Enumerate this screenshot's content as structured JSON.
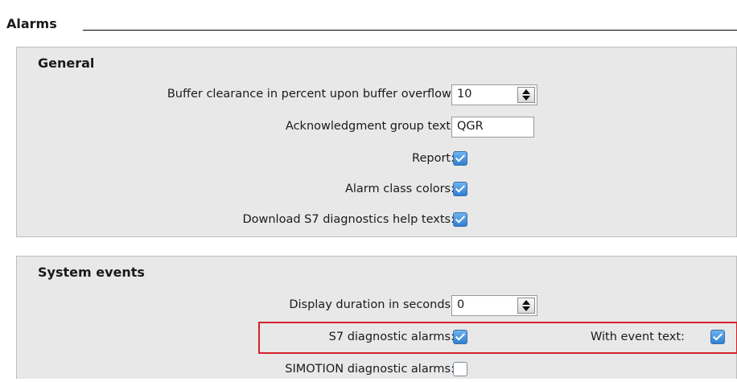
{
  "section": {
    "title": "Alarms"
  },
  "general": {
    "title": "General",
    "buffer_clearance": {
      "label": "Buffer clearance in percent upon buffer overflow:",
      "value": "10"
    },
    "ack_group_text": {
      "label": "Acknowledgment group text:",
      "value": "QGR"
    },
    "report": {
      "label": "Report:",
      "checked": true
    },
    "alarm_class_colors": {
      "label": "Alarm class colors:",
      "checked": true
    },
    "download_s7_help": {
      "label": "Download S7 diagnostics help texts:",
      "checked": true
    }
  },
  "system_events": {
    "title": "System events",
    "display_duration": {
      "label": "Display duration in seconds:",
      "value": "0"
    },
    "s7_diagnostic_alarms": {
      "label": "S7 diagnostic alarms:",
      "checked": true
    },
    "with_event_text": {
      "label": "With event text:",
      "checked": true
    },
    "simotion_diagnostic_alarms": {
      "label": "SIMOTION diagnostic alarms:",
      "checked": false
    }
  },
  "colors": {
    "highlight": "#d2232a",
    "checkbox_checked": "#2f7fd3",
    "panel_bg": "#e8e8e8"
  },
  "icons": {
    "spinner": "spin-up-down-icon",
    "check": "checkmark-icon"
  }
}
